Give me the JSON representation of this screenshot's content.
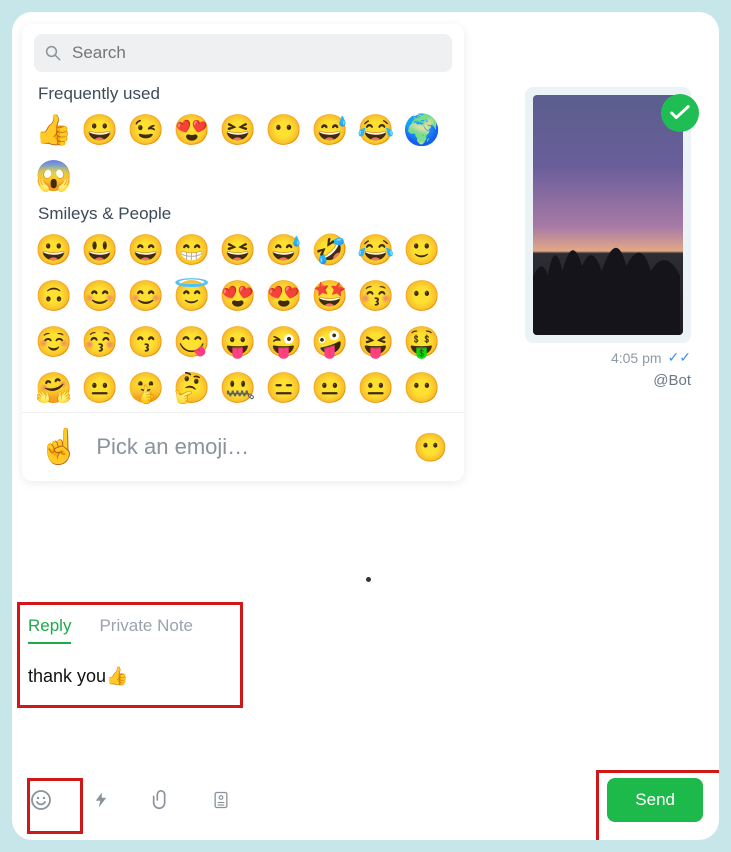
{
  "search": {
    "placeholder": "Search"
  },
  "sections": {
    "frequent": "Frequently used",
    "smileys": "Smileys & People"
  },
  "frequent_emojis": [
    "👍",
    "😀",
    "😉",
    "😍",
    "😆",
    "😶",
    "😅",
    "😂",
    "🌍",
    "😱"
  ],
  "smileys_emojis": [
    "😀",
    "😃",
    "😄",
    "😁",
    "😆",
    "😅",
    "🤣",
    "😂",
    "🙂",
    "🙃",
    "😊",
    "😊",
    "😇",
    "😍",
    "😍",
    "🤩",
    "😚",
    "😶",
    "☺️",
    "😚",
    "😙",
    "😋",
    "😛",
    "😜",
    "🤪",
    "😝",
    "🤑",
    "🤗",
    "😐",
    "🤫",
    "🤔",
    "🤐",
    "😑",
    "😐",
    "😐",
    "😶"
  ],
  "picker": {
    "prompt": "Pick an emoji…",
    "hand": "☝️",
    "dot": "😶"
  },
  "message": {
    "time": "4:05 pm",
    "author": "@Bot"
  },
  "tabs": {
    "reply": "Reply",
    "private": "Private Note"
  },
  "compose": {
    "text": "thank you👍"
  },
  "send": {
    "label": "Send"
  }
}
